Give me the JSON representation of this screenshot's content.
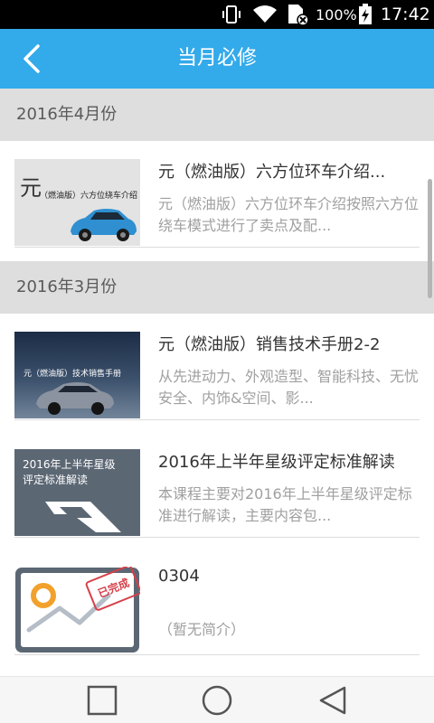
{
  "status_bar": {
    "battery_percent": "100%",
    "time": "17:42"
  },
  "header": {
    "title": "当月必修",
    "back_icon": "chevron-left-icon"
  },
  "colors": {
    "accent": "#33aaea",
    "section_bg": "#dedede",
    "completed_stamp": "#d6404a"
  },
  "sections": [
    {
      "label": "2016年4月份",
      "items": [
        {
          "title": "元（燃油版）六方位环车介绍...",
          "desc": "元（燃油版）六方位环车介绍按照六方位绕车模式进行了卖点及配...",
          "thumb_caption": "（燃油版）六方位绕车介绍",
          "thumb_logo": "元"
        }
      ]
    },
    {
      "label": "2016年3月份",
      "items": [
        {
          "title": "元（燃油版）销售技术手册2-2",
          "desc": "从先进动力、外观造型、智能科技、无忧安全、内饰&空间、影...",
          "thumb_caption": "元（燃油版）技术销售手册"
        },
        {
          "title": "2016年上半年星级评定标准解读",
          "desc": "本课程主要对2016年上半年星级评定标准进行解读，主要内容包...",
          "thumb_line1": "2016年上半年星级",
          "thumb_line2": "评定标准解读"
        },
        {
          "title": "0304",
          "desc": "（暂无简介）",
          "stamp": "已完成"
        }
      ]
    }
  ]
}
